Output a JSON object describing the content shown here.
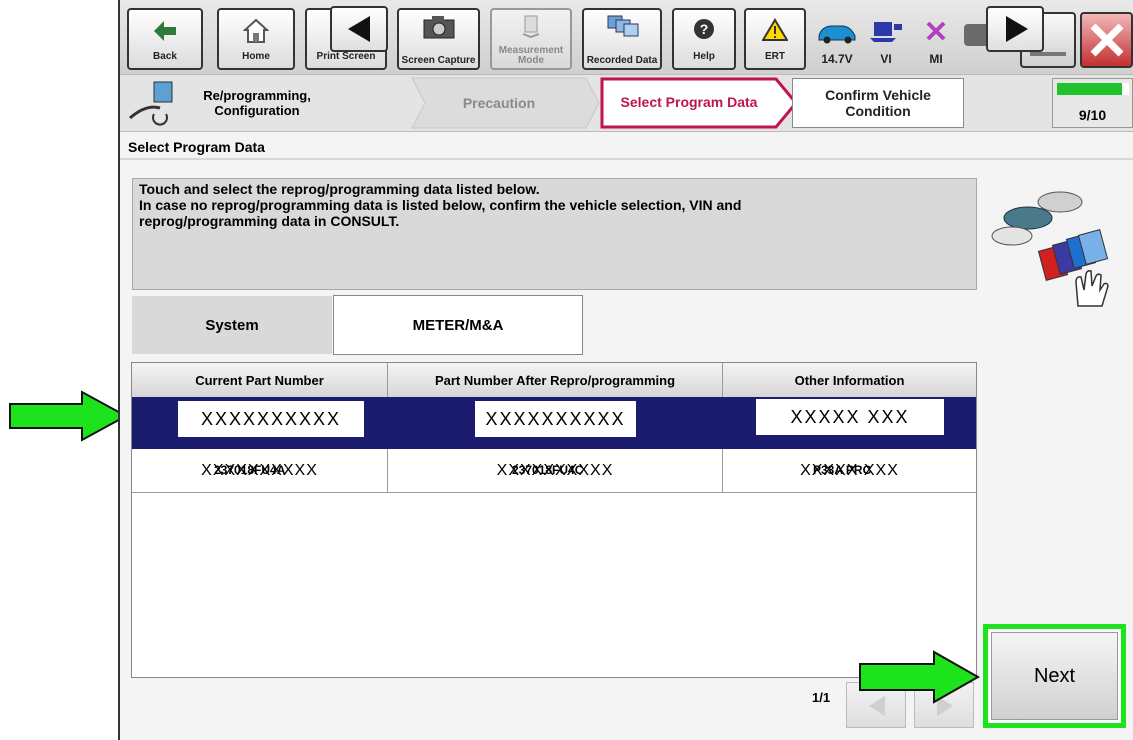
{
  "toolbar": {
    "back": "Back",
    "home": "Home",
    "print_screen": "Print Screen",
    "screen_capture": "Screen Capture",
    "measurement_mode": "Measurement Mode",
    "recorded_data": "Recorded Data",
    "help": "Help",
    "ert": "ERT",
    "battery_voltage": "14.7V",
    "vi": "VI",
    "mi": "MI"
  },
  "nav": {
    "breadcrumb_label": "Re/programming, Configuration",
    "steps": [
      "Precaution",
      "Select Program Data",
      "Confirm Vehicle Condition"
    ],
    "active_step": "Select Program Data",
    "progress_text": "9/10",
    "progress_fraction": 0.9
  },
  "page_title": "Select Program Data",
  "instructions": {
    "line1": "Touch and select the reprog/programming data listed below.",
    "line2": "In case no reprog/programming data is listed below, confirm the vehicle selection, VIN and",
    "line3": "reprog/programming data in CONSULT."
  },
  "system": {
    "label": "System",
    "value": "METER/M&A"
  },
  "table": {
    "headers": [
      "Current Part Number",
      "Part Number After Repro/programming",
      "Other Information"
    ],
    "selected_row": [
      "XXXXXXXXXX",
      "XXXXXXXXXX",
      "XXXXX XXX"
    ],
    "row2": [
      "XXXXXXXXXX",
      "XXXXXXXXXX",
      "XXXXX XXX"
    ],
    "row2_overlay": [
      "237018FU4A",
      "237018FU4C",
      "P33A PRC"
    ]
  },
  "pagination": "1/1",
  "next_button": "Next",
  "colors": {
    "highlight_green": "#1de31d",
    "selected_row": "#1c1c6f",
    "active_step_border": "#c0154a"
  }
}
